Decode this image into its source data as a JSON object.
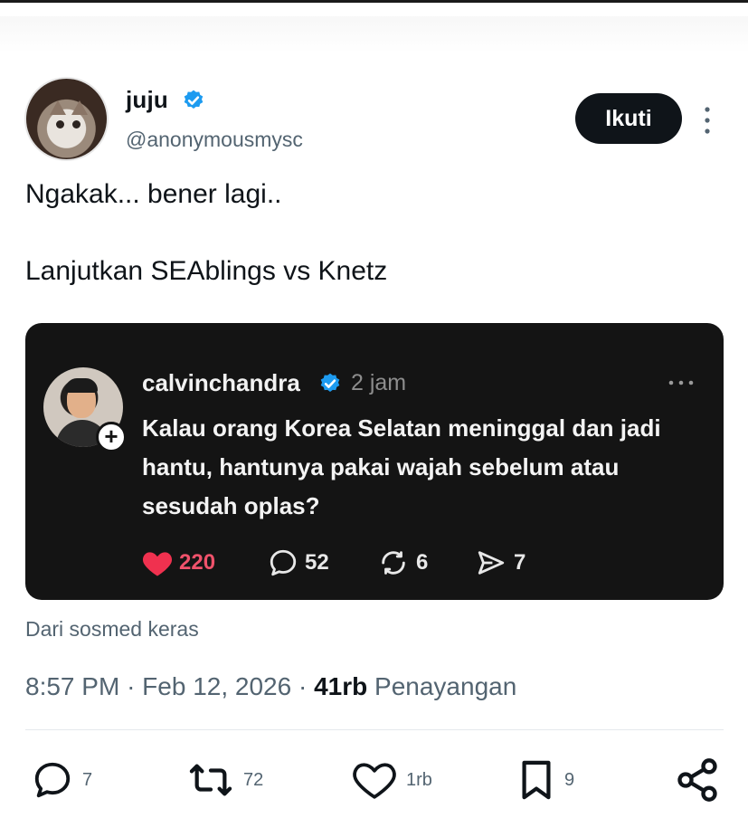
{
  "post": {
    "author_name": "juju",
    "author_handle": "@anonymousmysc",
    "follow_label": "Ikuti",
    "text_line1": "Ngakak... bener lagi..",
    "text_line2": "Lanjutkan SEAblings vs Knetz",
    "source_text": "Dari sosmed keras",
    "time": "8:57 PM",
    "date": "Feb 12, 2026",
    "views_count": "41rb",
    "views_label": "Penayangan",
    "separator": "·"
  },
  "quoted": {
    "author_name": "calvinchandra",
    "time_ago": "2 jam",
    "text": "Kalau orang Korea Selatan meninggal dan jadi hantu, hantunya pakai wajah sebelum atau sesudah oplas?",
    "likes": "220",
    "replies": "52",
    "reposts": "6",
    "shares": "7"
  },
  "actions": {
    "replies": "7",
    "reposts": "72",
    "likes": "1rb",
    "bookmarks": "9"
  },
  "colors": {
    "verified_blue": "#1d9bf0",
    "like_red": "#f0526b",
    "card_bg": "#141414",
    "secondary_text": "#536471"
  },
  "icons": {
    "verified": "verified-badge-icon",
    "more": "more-options-icon",
    "reply": "reply-icon",
    "repost": "repost-icon",
    "like": "heart-icon",
    "bookmark": "bookmark-icon",
    "share": "share-icon",
    "send": "send-icon"
  }
}
